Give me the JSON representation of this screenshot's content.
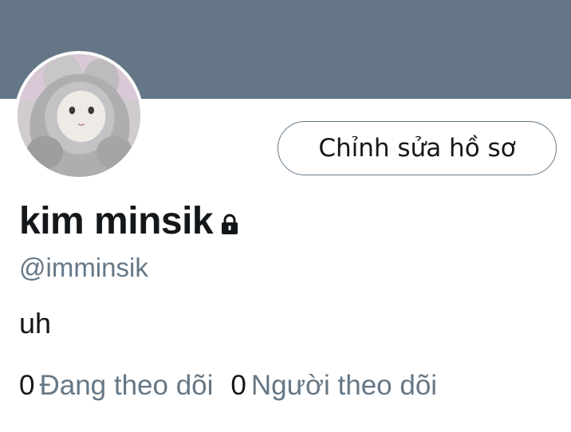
{
  "profile": {
    "banner_color": "#657786",
    "display_name": "kim minsik",
    "handle": "@imminsik",
    "bio": "uh",
    "protected_icon": "lock-icon",
    "avatar_icon": "avatar-photo",
    "edit_button_label": "Chỉnh sửa hồ sơ"
  },
  "stats": {
    "following_count": "0",
    "following_label": "Đang theo dõi",
    "followers_count": "0",
    "followers_label": "Người theo dõi"
  }
}
